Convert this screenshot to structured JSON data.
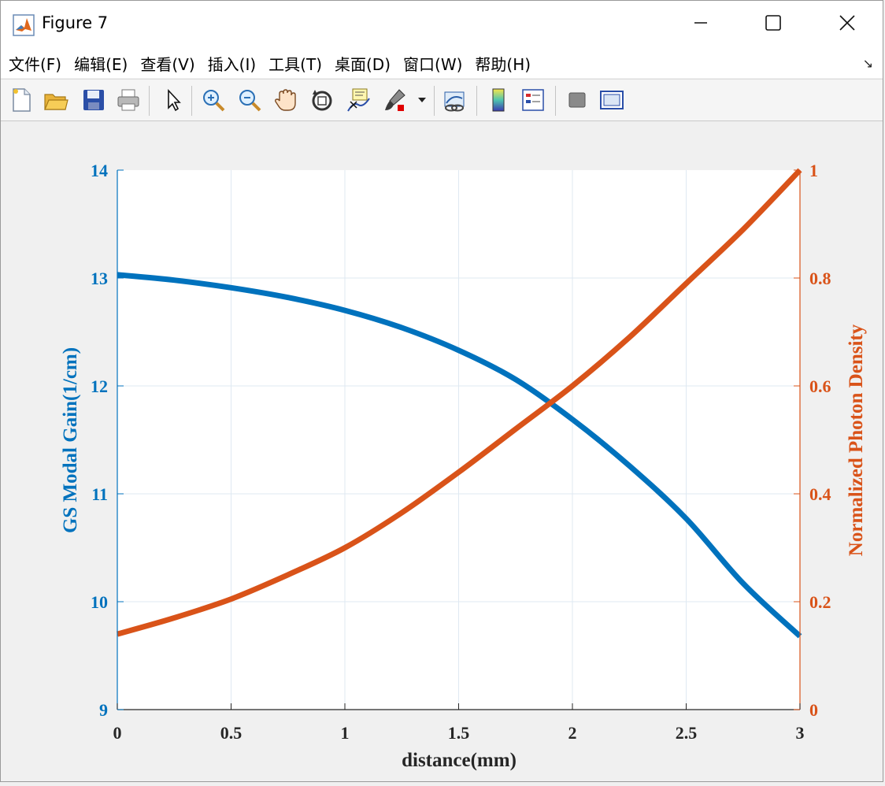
{
  "window": {
    "title": "Figure 7",
    "icon": "matlab-logo-icon",
    "controls": [
      "minimize-icon",
      "maximize-icon",
      "close-icon"
    ]
  },
  "menu": {
    "items": [
      "文件(F)",
      "编辑(E)",
      "查看(V)",
      "插入(I)",
      "工具(T)",
      "桌面(D)",
      "窗口(W)",
      "帮助(H)"
    ],
    "more_icon": "dock-arrow-icon"
  },
  "toolbar": {
    "icons": [
      "new-figure-icon",
      "open-file-icon",
      "save-icon",
      "print-icon",
      "select-arrow-icon",
      "zoom-in-icon",
      "zoom-out-icon",
      "pan-hand-icon",
      "rotate-3d-icon",
      "data-cursor-icon",
      "brush-icon",
      "brush-dropdown-icon",
      "link-plot-icon",
      "colorbar-icon",
      "legend-icon",
      "hide-plot-tools-icon",
      "show-plot-tools-icon"
    ]
  },
  "colors": {
    "left": "#0072BD",
    "right": "#D95319",
    "axis": "#262626",
    "grid": "#DFE9F2"
  },
  "chart_data": {
    "type": "line",
    "xlabel": "distance(mm)",
    "xlim": [
      0,
      3
    ],
    "xticks": [
      "0",
      "0.5",
      "1",
      "1.5",
      "2",
      "2.5",
      "3"
    ],
    "grid": true,
    "left_axis": {
      "label": "GS Modal Gain(1/cm)",
      "lim": [
        9,
        14
      ],
      "ticks": [
        "9",
        "10",
        "11",
        "12",
        "13",
        "14"
      ]
    },
    "right_axis": {
      "label": "Normalized Photon Density",
      "lim": [
        0,
        1
      ],
      "ticks": [
        "0",
        "0.2",
        "0.4",
        "0.6",
        "0.8",
        "1"
      ]
    },
    "series": [
      {
        "axis": "left",
        "x": [
          0,
          0.25,
          0.5,
          0.75,
          1.0,
          1.25,
          1.5,
          1.75,
          2.0,
          2.25,
          2.5,
          2.75,
          3.0
        ],
        "values": [
          13.03,
          12.98,
          12.91,
          12.82,
          12.7,
          12.54,
          12.33,
          12.06,
          11.69,
          11.26,
          10.77,
          10.17,
          9.68
        ]
      },
      {
        "axis": "right",
        "x": [
          0,
          0.25,
          0.5,
          0.75,
          1.0,
          1.25,
          1.5,
          1.75,
          2.0,
          2.25,
          2.5,
          2.75,
          3.0
        ],
        "values": [
          0.14,
          0.17,
          0.205,
          0.25,
          0.3,
          0.365,
          0.44,
          0.52,
          0.6,
          0.69,
          0.79,
          0.89,
          1.0
        ]
      }
    ]
  }
}
